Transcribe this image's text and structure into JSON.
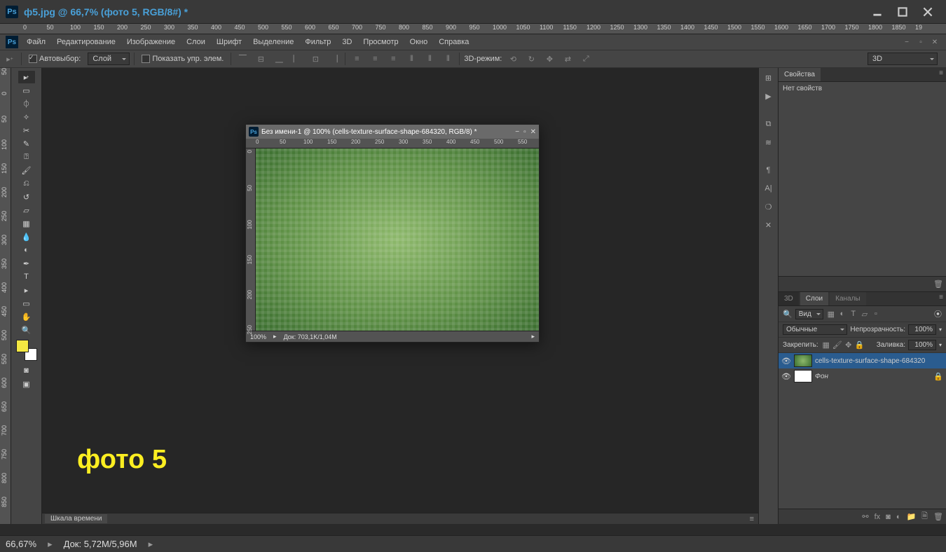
{
  "titlebar": {
    "ps_label": "Ps",
    "title": "ф5.jpg @ 66,7% (фото 5, RGB/8#) *"
  },
  "menubar": {
    "ps_label": "Ps",
    "items": [
      "Файл",
      "Редактирование",
      "Изображение",
      "Слои",
      "Шрифт",
      "Выделение",
      "Фильтр",
      "3D",
      "Просмотр",
      "Окно",
      "Справка"
    ]
  },
  "options": {
    "auto_select_label": "Автовыбор:",
    "layer_dd": "Слой",
    "show_controls_label": "Показать упр. элем.",
    "mode_3d_label": "3D-режим:",
    "workspace_dd": "3D"
  },
  "top_ruler_vals": [
    "0",
    "50",
    "100",
    "150",
    "200",
    "250",
    "300",
    "350",
    "400",
    "450",
    "500",
    "550",
    "600",
    "650",
    "700",
    "750",
    "800",
    "850",
    "900",
    "950",
    "1000",
    "1050",
    "1100",
    "1150",
    "1200",
    "1250",
    "1300",
    "1350",
    "1400",
    "1450",
    "1500",
    "1550",
    "1600",
    "1650",
    "1700",
    "1750",
    "1800",
    "1850",
    "19"
  ],
  "left_ruler_vals": [
    "50",
    "0",
    "50",
    "100",
    "150",
    "200",
    "250",
    "300",
    "350",
    "400",
    "450",
    "500",
    "550",
    "600",
    "650",
    "700",
    "750",
    "800",
    "850"
  ],
  "timeline": {
    "label": "Шкала времени"
  },
  "floating": {
    "title": "Без имени-1 @ 100% (cells-texture-surface-shape-684320, RGB/8) *",
    "ruler_h": [
      "0",
      "50",
      "100",
      "150",
      "200",
      "250",
      "300",
      "350",
      "400",
      "450",
      "500",
      "550"
    ],
    "ruler_v": [
      "0",
      "50",
      "100",
      "150",
      "200",
      "250"
    ],
    "zoom": "100%",
    "doc_size": "Док: 703,1K/1,04M"
  },
  "canvas_text": "фото 5",
  "panels": {
    "properties": {
      "tab": "Свойства",
      "empty": "Нет свойств"
    },
    "layers": {
      "tab_3d": "3D",
      "tab_layers": "Слои",
      "tab_channels": "Каналы",
      "kind_label": "Вид",
      "blend_mode": "Обычные",
      "opacity_label": "Непрозрачность:",
      "opacity_value": "100%",
      "lock_label": "Закрепить:",
      "fill_label": "Заливка:",
      "fill_value": "100%",
      "layer1": "cells-texture-surface-shape-684320",
      "layer2": "Фон"
    }
  },
  "status": {
    "zoom": "66,67%",
    "doc": "Док: 5,72M/5,96M"
  },
  "colors": {
    "foreground": "#f4e842",
    "background": "#ffffff"
  }
}
